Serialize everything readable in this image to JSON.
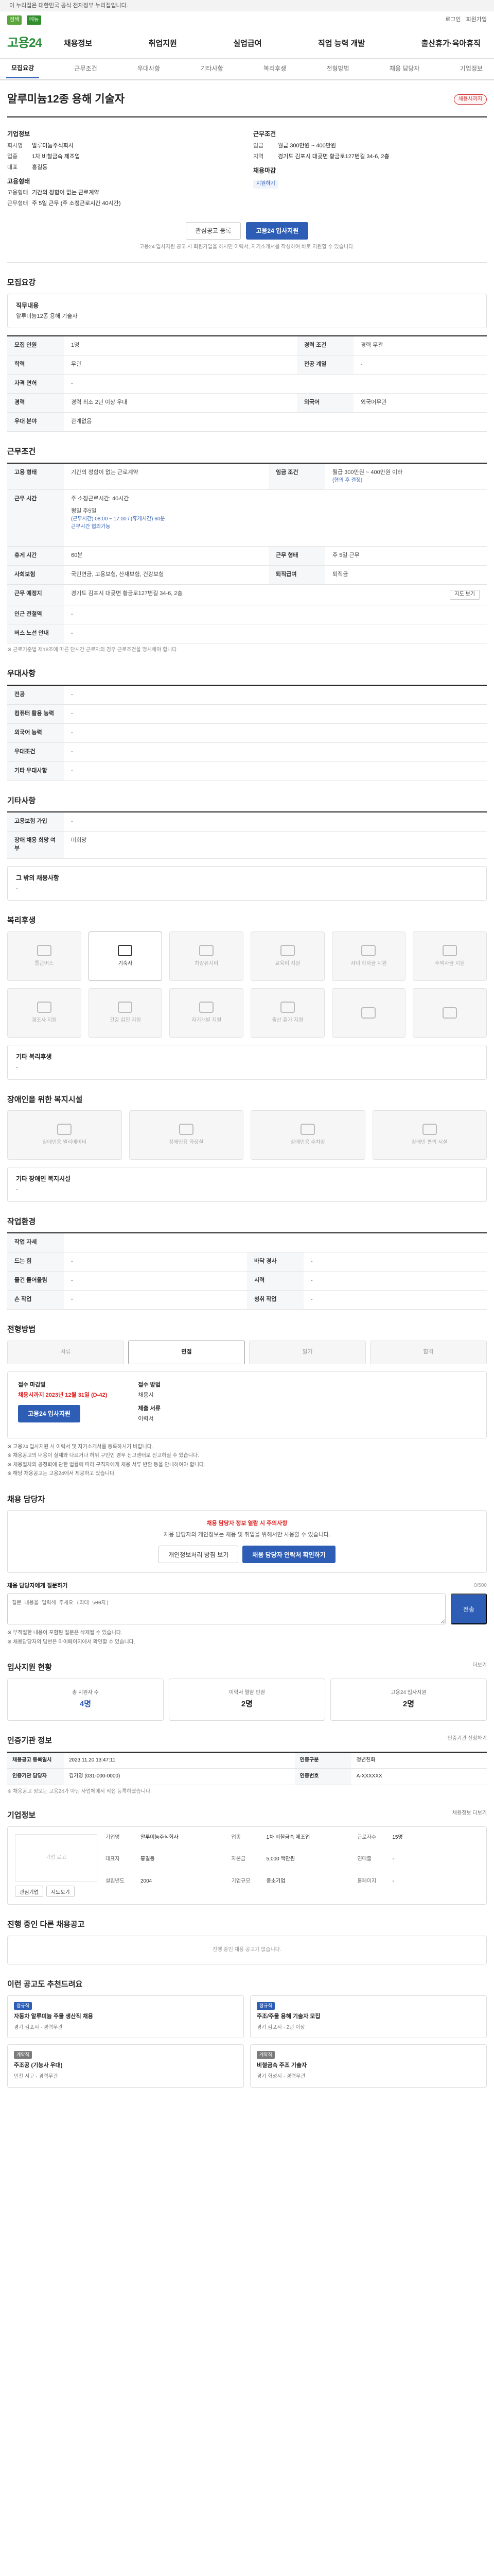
{
  "gov_bar": "이 누리집은 대한민국 공식 전자정부 누리집입니다.",
  "util": {
    "search1": "검색",
    "search2": "메뉴",
    "login": "로그인",
    "join": "회원가입"
  },
  "nav": {
    "logo_a": "고용",
    "logo_b": "24",
    "items": [
      "채용정보",
      "취업지원",
      "실업급여",
      "직업 능력 개발",
      "출산휴가·육아휴직"
    ]
  },
  "sub_tabs": [
    "모집요강",
    "근무조건",
    "우대사항",
    "기타사항",
    "복리후생",
    "전형방법",
    "채용 담당자",
    "기업정보"
  ],
  "job": {
    "title": "알루미늄12종 용해 기술자",
    "status": "채용시까지",
    "company_title": "기업정보",
    "company_rows": [
      [
        "회사명",
        "알루미늄주식회사"
      ],
      [
        "업종",
        "1차 비철금속 제조업"
      ],
      [
        "대표",
        "홍길동"
      ]
    ],
    "app_title": "고용형태",
    "app_rows": [
      [
        "고용형태",
        "기간의 정함이 없는 근로계약"
      ],
      [
        "근무형태",
        "주 5일 근무 (주 소정근로시간 40시간)"
      ]
    ],
    "cond_title": "근무조건",
    "cond_rows": [
      [
        "임금",
        "월급 300만원 ~ 400만원"
      ],
      [
        "지역",
        "경기도 김포시 대곶면 황금로127번길 34-6, 2층"
      ]
    ],
    "edu_title": "채용마감",
    "edu_badge": "지원하기",
    "btn_scrap": "관심공고 등록",
    "btn_apply": "고용24 입사지원",
    "notice": "고용24 입사지원 공고 시 회원가입을 하시면 이력서, 자기소개서를 작성하여 바로 지원할 수 있습니다."
  },
  "recruit": {
    "title": "모집요강",
    "duty_label": "직무내용",
    "duty_text": "알루미늄12종 용해 기술자",
    "rows": [
      [
        "모집 인원",
        "1명",
        "경력 조건",
        "경력 무관"
      ],
      [
        "학력",
        "무관",
        "전공 계열",
        "-"
      ],
      [
        "자격 면허",
        "-",
        "",
        ""
      ],
      [
        "경력",
        "경력 최소 2년 이상 우대",
        "외국어",
        "외국어무관"
      ],
      [
        "우대 분야",
        "관계없음",
        "",
        ""
      ]
    ]
  },
  "work": {
    "title": "근무조건",
    "employ_type": "기간의 정함이 없는 근로계약",
    "salary_k": "임금 조건",
    "salary_v": "월급 300만원 ~ 400만원 이하",
    "salary_note": "(협의 후 결정)",
    "hours_k": "근무 시간",
    "hours_v1": "주 소정근로시간: 40시간",
    "hours_v2": "평일 주5일",
    "hours_v3": "(근무시간) 08:00 ~ 17:00 / (휴게시간) 60분",
    "hours_hint": "근무시간 협의가능",
    "rows": [
      [
        "휴게 시간",
        "60분",
        "근무 형태",
        "주 5일 근무"
      ],
      [
        "사회보험",
        "국민연금, 고용보험, 산재보험, 건강보험",
        "퇴직급여",
        "퇴직금"
      ],
      [
        "근무 예정지",
        "경기도 김포시 대곶면 황금로127번길 34-6, 2층",
        "",
        ""
      ],
      [
        "인근 전철역",
        "-",
        "",
        ""
      ],
      [
        "버스 노선 안내",
        "-",
        "",
        ""
      ]
    ],
    "map_btn": "지도 보기",
    "footnote": "※ 근로기준법 제18조에 따른 단시간 근로자의 경우 근로조건을 명시해야 합니다."
  },
  "pref": {
    "title": "우대사항",
    "rows": [
      [
        "전공",
        "-"
      ],
      [
        "컴퓨터 활용 능력",
        "-"
      ],
      [
        "외국어 능력",
        "-"
      ],
      [
        "우대조건",
        "-"
      ],
      [
        "기타 우대사항",
        "-"
      ]
    ]
  },
  "etc": {
    "title": "기타사항",
    "rows": [
      [
        "고용보험 가입",
        "-"
      ],
      [
        "장애 채용 희망 여부",
        "미희망"
      ]
    ],
    "box_label": "그 밖의 채용사항",
    "box_text": "-"
  },
  "welfare": {
    "title": "복리후생",
    "tiles": [
      "통근버스",
      "기숙사",
      "차량유지비",
      "교육비 지원",
      "자녀 학자금 지원",
      "주택자금 지원",
      "경조사 지원",
      "건강 검진 지원",
      "자기개발 지원",
      "출산 휴가 지원",
      "",
      ""
    ],
    "box_label": "기타 복리후생",
    "box_text": "-"
  },
  "disability": {
    "title": "장애인을 위한 복지시설",
    "tiles": [
      "장애인용 엘리베이터",
      "장애인용 화장실",
      "장애인용 주차장",
      "장애인 편의 시설"
    ],
    "box_label": "기타 장애인 복지시설",
    "box_text": "-"
  },
  "env": {
    "title": "작업환경",
    "rows": [
      [
        "작업 자세",
        "",
        "",
        ""
      ],
      [
        "드는 힘",
        "-",
        "바닥 경사",
        "-"
      ],
      [
        "물건 들어올림",
        "-",
        "시력",
        "-"
      ],
      [
        "손 작업",
        "-",
        "청취 작업",
        "-"
      ]
    ]
  },
  "process": {
    "title": "전형방법",
    "steps": [
      "서류",
      "면접",
      "필기",
      "합격"
    ],
    "apply_k1": "접수 마감일",
    "apply_v1": "채용시까지 2023년 12월 31일 (D-42)",
    "apply_k2": "접수 방법",
    "apply_v2": "채용시",
    "apply_k3": "제출 서류",
    "apply_v3": "이력서",
    "apply_btn": "고용24 입사지원",
    "bullets": [
      "※ 고용24 입사지원 시 이력서 및 자기소개서를 등록하시기 바랍니다.",
      "※ 채용공고의 내용이 실제와 다르거나 허위 구인인 경우 신고센터로 신고하실 수 있습니다.",
      "※ 채용절차의 공정화에 관한 법률에 따라 구직자에게 채용 서류 반환 등을 안내하여야 합니다.",
      "※ 해당 채용공고는 고용24에서 제공하고 있습니다."
    ]
  },
  "manager": {
    "title": "채용 담당자",
    "alert_title": "채용 담당자 정보 열람 시 주의사항",
    "alert_text": "채용 담당자의 개인정보는 채용 및 취업을 위해서만 사용할 수 있습니다.",
    "btn1": "개인정보처리 방침 보기",
    "btn2": "채용 담당자 연락처 확인하기",
    "qa_title": "채용 담당자에게 질문하기",
    "qa_placeholder": "질문 내용을 입력해 주세요 (최대 500자)",
    "qa_send": "전송",
    "qa_count": "0/500",
    "qa_notes": [
      "※ 부적절한 내용이 포함된 질문은 삭제될 수 있습니다.",
      "※ 채용담당자의 답변은 마이페이지에서 확인할 수 있습니다."
    ]
  },
  "stats": {
    "title": "입사지원 현황",
    "more": "더보기",
    "items": [
      [
        "총 지원자 수",
        "4명"
      ],
      [
        "이력서 열람 인원",
        "2명"
      ],
      [
        "고용24 입사지원",
        "2명"
      ]
    ]
  },
  "cert": {
    "title": "인증기관 정보",
    "btn": "인증기관 신청하기",
    "rows": [
      [
        "채용공고 등록일시",
        "2023.11.20 13:47:11",
        "인증구분",
        "청년친화"
      ],
      [
        "인증기관 담당자",
        "김가영 (031-000-0000)",
        "인증번호",
        "A-XXXXXX"
      ]
    ],
    "notes": "※ 채용공고 정보는 고용24가 아닌 사업체에서 직접 등록하였습니다."
  },
  "company": {
    "title": "기업정보",
    "btn": "채용정보 더보기",
    "logo_ph": "기업 로고",
    "fields": [
      [
        "기업명",
        "알루미늄주식회사"
      ],
      [
        "업종",
        "1차 비철금속 제조업"
      ],
      [
        "근로자수",
        "15명"
      ],
      [
        "대표자",
        "홍길동"
      ],
      [
        "자본금",
        "5,000 백만원"
      ],
      [
        "연매출",
        "-"
      ],
      [
        "설립년도",
        "2004"
      ],
      [
        "기업규모",
        "중소기업"
      ],
      [
        "홈페이지",
        "-"
      ]
    ],
    "btn_a": "관심기업",
    "btn_b": "지도보기"
  },
  "other": {
    "title": "진행 중인 다른 채용공고",
    "empty": "진행 중인 채용 공고가 없습니다."
  },
  "recommend": {
    "title": "이런 공고도 추천드려요",
    "cards": [
      {
        "tag": "정규직",
        "title": "자동차 알루미늄 주물 생산직 채용",
        "meta": "경기 김포시 · 경력무관"
      },
      {
        "tag": "정규직",
        "title": "주조/주물 용해 기술자 모집",
        "meta": "경기 김포시 · 2년 이상"
      },
      {
        "tag": "계약직",
        "title": "주조공 (기능사 우대)",
        "meta": "인천 서구 · 경력무관"
      },
      {
        "tag": "계약직",
        "title": "비철금속 주조 기술자",
        "meta": "경기 화성시 · 경력무관"
      }
    ]
  },
  "colors": {
    "brand": "#2d8c3c",
    "primary": "#2d5db4",
    "alert": "#d22222"
  }
}
